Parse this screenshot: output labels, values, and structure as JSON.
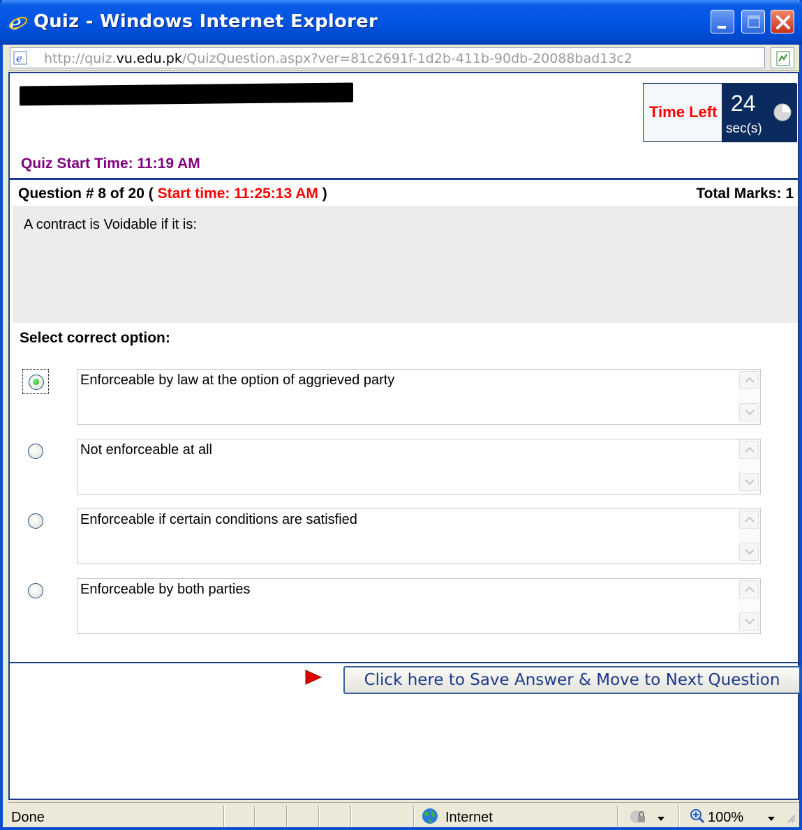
{
  "window": {
    "title": "Quiz - Windows Internet Explorer",
    "accent_color": "#0054e3"
  },
  "address": {
    "url_prefix": "http://quiz.",
    "url_domain": "vu.edu.pk",
    "url_rest": "/QuizQuestion.aspx?ver=81c2691f-1d2b-411b-90db-20088bad13c2"
  },
  "timer": {
    "label": "Time Left",
    "value": "24",
    "unit": "sec(s)"
  },
  "quiz": {
    "start_time_text": "Quiz Start Time: 11:19 AM",
    "question_prefix": "Question # 8 of 20 (",
    "question_start": "Start time: 11:25:13 AM",
    "question_suffix": ")",
    "total_marks": "Total Marks: 1",
    "question_text": "A contract is Voidable if it is:",
    "select_label": "Select correct option:",
    "options": [
      {
        "text": "Enforceable by law at the option of aggrieved party",
        "selected": true
      },
      {
        "text": "Not enforceable at all",
        "selected": false
      },
      {
        "text": "Enforceable if certain conditions are satisfied",
        "selected": false
      },
      {
        "text": "Enforceable by both parties",
        "selected": false
      }
    ],
    "save_button": "Click here to Save Answer & Move to Next Question"
  },
  "status": {
    "left": "Done",
    "zone": "Internet",
    "zoom": "100%"
  }
}
